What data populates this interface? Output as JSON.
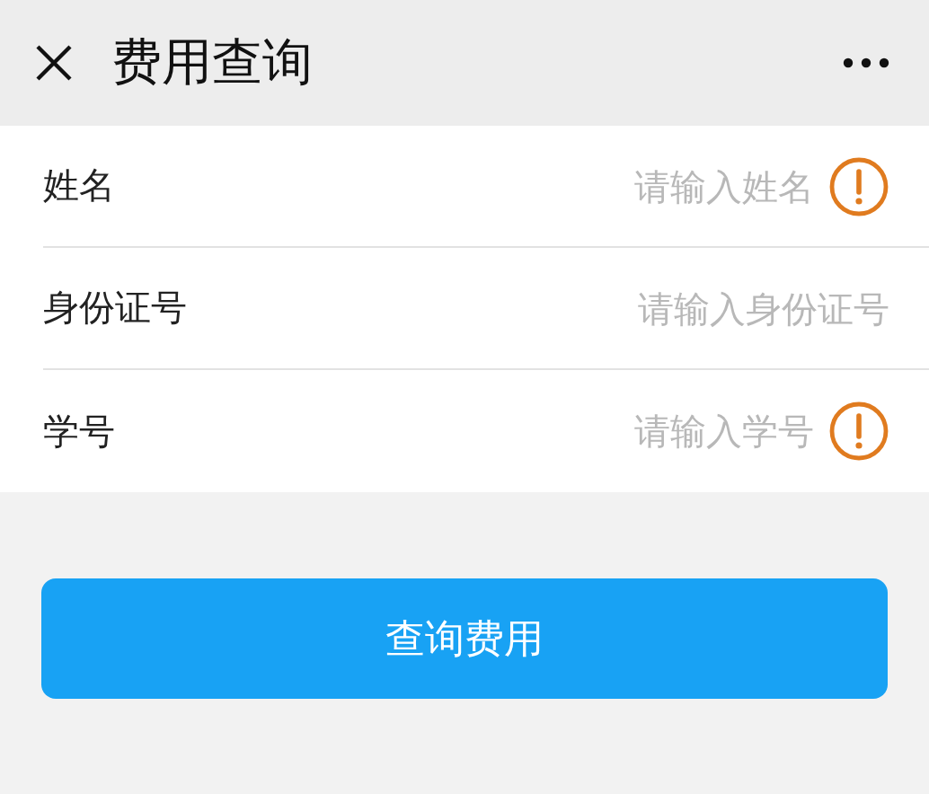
{
  "header": {
    "title": "费用查询"
  },
  "fields": [
    {
      "label": "姓名",
      "placeholder": "请输入姓名",
      "warning": true
    },
    {
      "label": "身份证号",
      "placeholder": "请输入身份证号",
      "warning": false
    },
    {
      "label": "学号",
      "placeholder": "请输入学号",
      "warning": true
    }
  ],
  "submit_button": "查询费用"
}
